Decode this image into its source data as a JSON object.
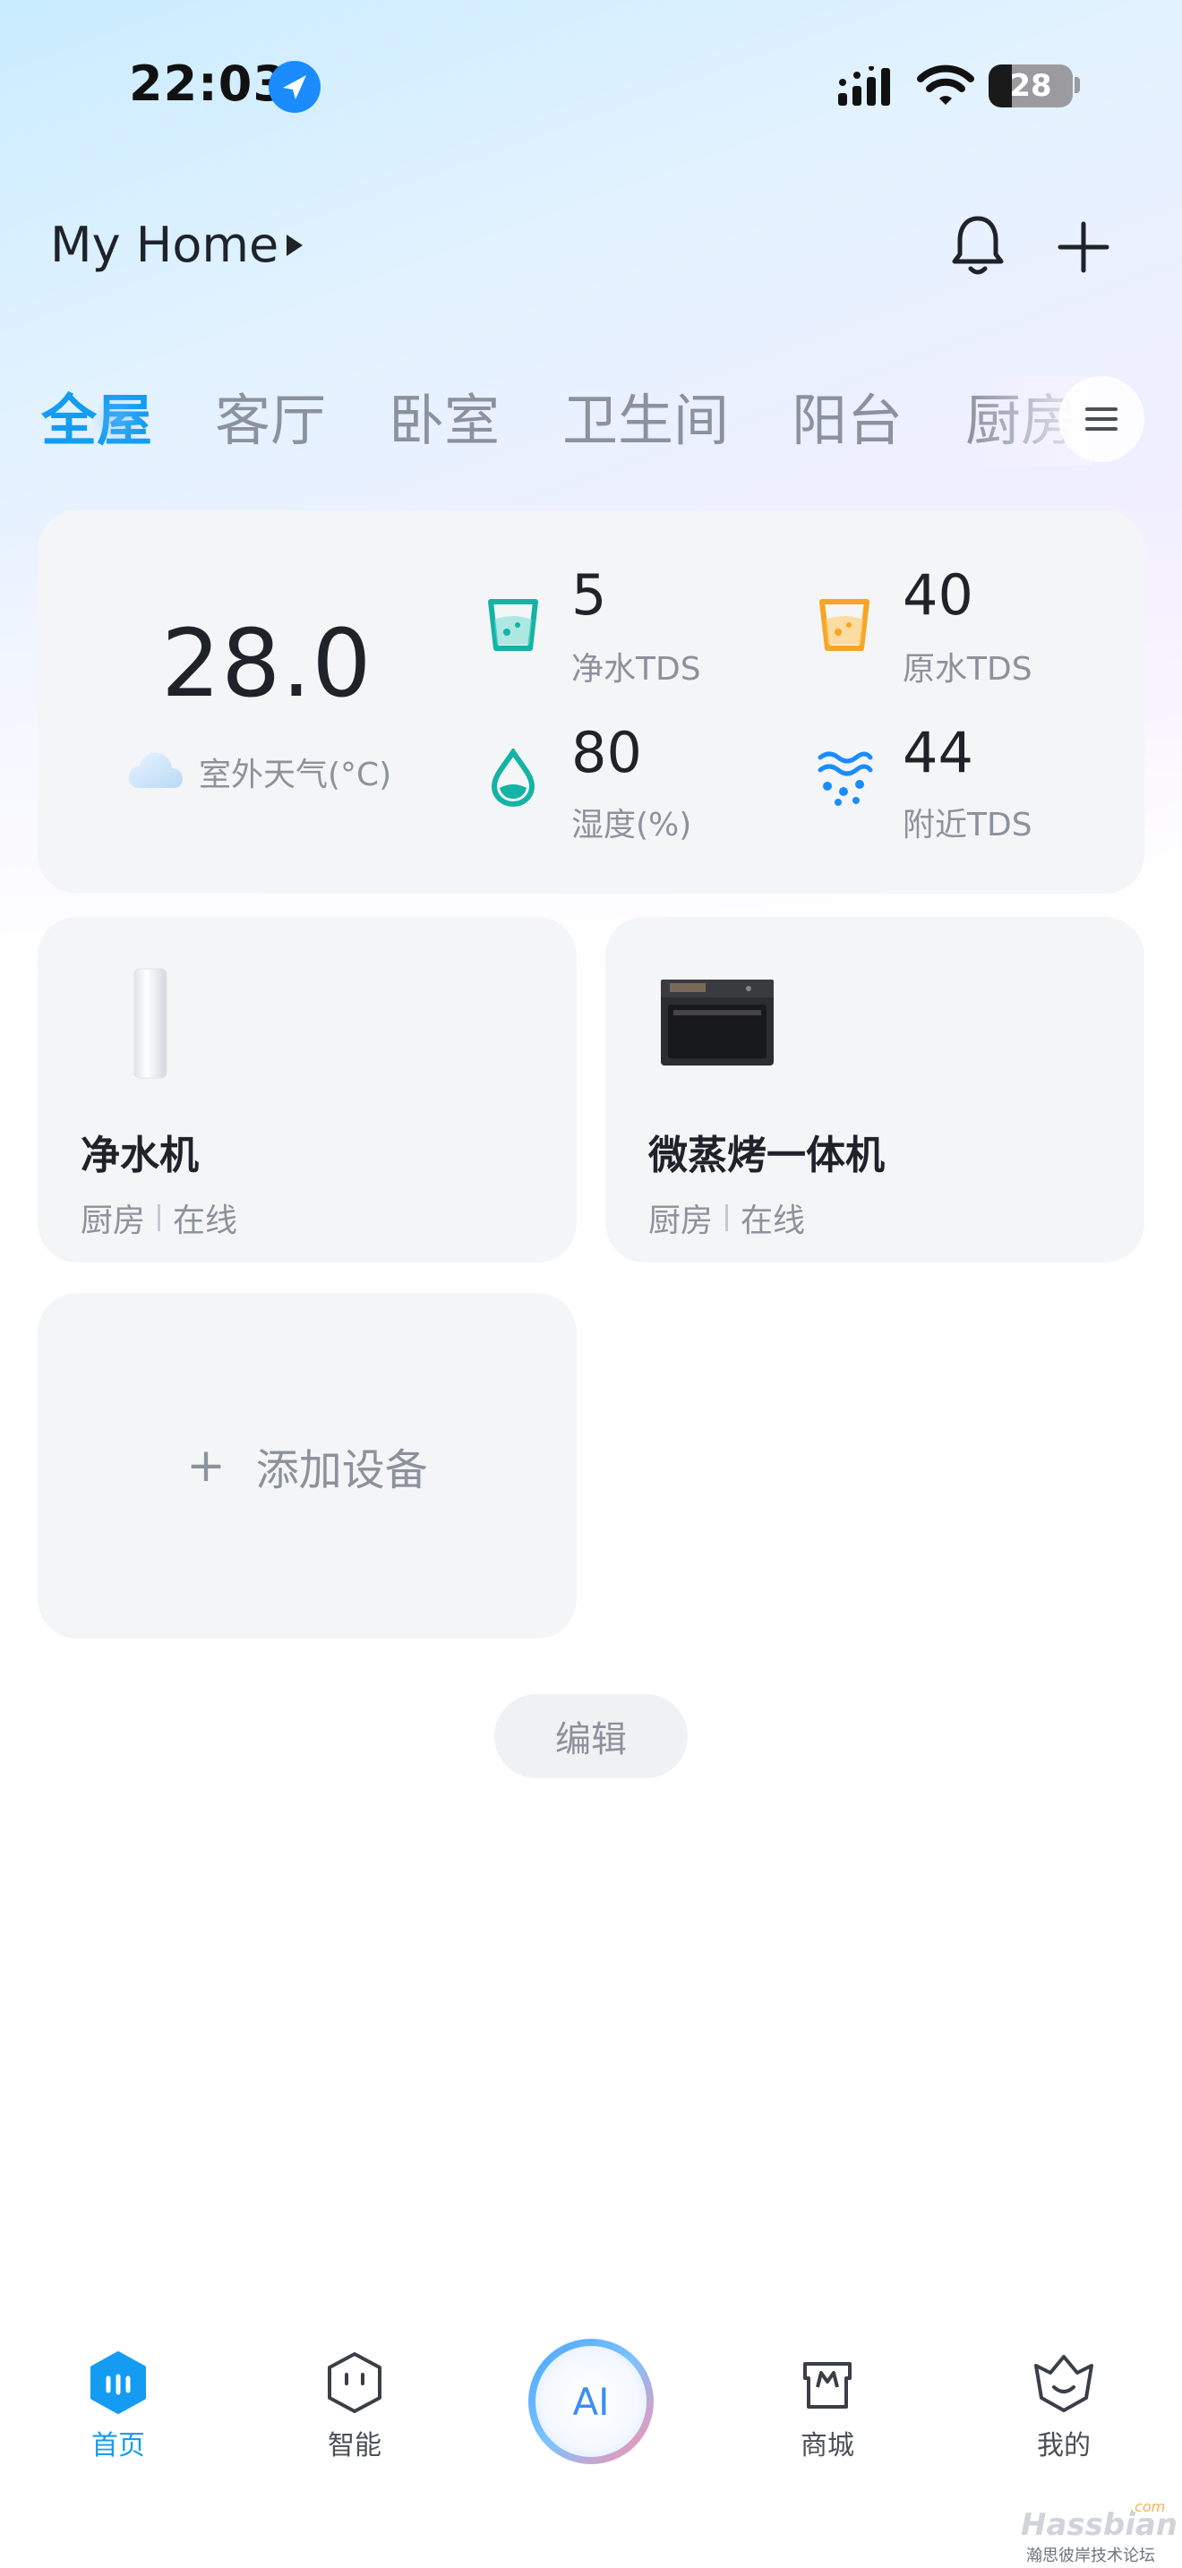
{
  "status_bar": {
    "time": "22:03",
    "battery_level": 28,
    "battery_text": "28",
    "icons": [
      "location-arrow-icon",
      "cellular-signal-icon",
      "wifi-icon",
      "battery-icon"
    ]
  },
  "header": {
    "home_name": "My Home",
    "icons": [
      "caret-right-icon",
      "bell-icon",
      "plus-icon"
    ]
  },
  "tabs": {
    "items": [
      {
        "label": "全屋",
        "active": true
      },
      {
        "label": "客厅",
        "active": false
      },
      {
        "label": "卧室",
        "active": false
      },
      {
        "label": "卫生间",
        "active": false
      },
      {
        "label": "阳台",
        "active": false
      },
      {
        "label": "厨房",
        "active": false
      }
    ],
    "menu_icon": "hamburger-menu-icon"
  },
  "env": {
    "temperature": "28.0",
    "weather_label": "室外天气(°C)",
    "weather_icon": "cloud-icon",
    "stats": [
      {
        "value": "5",
        "label": "净水TDS",
        "icon": "purified-water-cup-icon",
        "color": "#14b3a5"
      },
      {
        "value": "40",
        "label": "原水TDS",
        "icon": "raw-water-cup-icon",
        "color": "#f5a623"
      },
      {
        "value": "80",
        "label": "湿度(%)",
        "icon": "humidity-drop-icon",
        "color": "#14b3a5"
      },
      {
        "value": "44",
        "label": "附近TDS",
        "icon": "nearby-water-waves-icon",
        "color": "#1a8cff"
      }
    ]
  },
  "devices": [
    {
      "name": "净水机",
      "room": "厨房",
      "status": "在线",
      "icon": "water-purifier-icon"
    },
    {
      "name": "微蒸烤一体机",
      "room": "厨房",
      "status": "在线",
      "icon": "steam-oven-icon"
    }
  ],
  "add_device": {
    "label": "添加设备"
  },
  "edit": {
    "label": "编辑"
  },
  "bottom_nav": {
    "items": [
      {
        "label": "首页",
        "icon": "home-icon",
        "active": true
      },
      {
        "label": "智能",
        "icon": "smart-face-icon",
        "active": false
      },
      {
        "label": "",
        "icon": "ai-icon",
        "text": "AI",
        "active": false
      },
      {
        "label": "商城",
        "icon": "mall-bag-icon",
        "active": false
      },
      {
        "label": "我的",
        "icon": "profile-crown-icon",
        "active": false
      }
    ]
  },
  "watermark": {
    "brand": "Hassbian",
    "sub": "瀚思彼岸技术论坛",
    "com": ".com"
  },
  "colors": {
    "accent": "#149cf2",
    "card_bg": "#f4f5f7",
    "text_primary": "#1f2329",
    "text_secondary": "#8c929c"
  }
}
